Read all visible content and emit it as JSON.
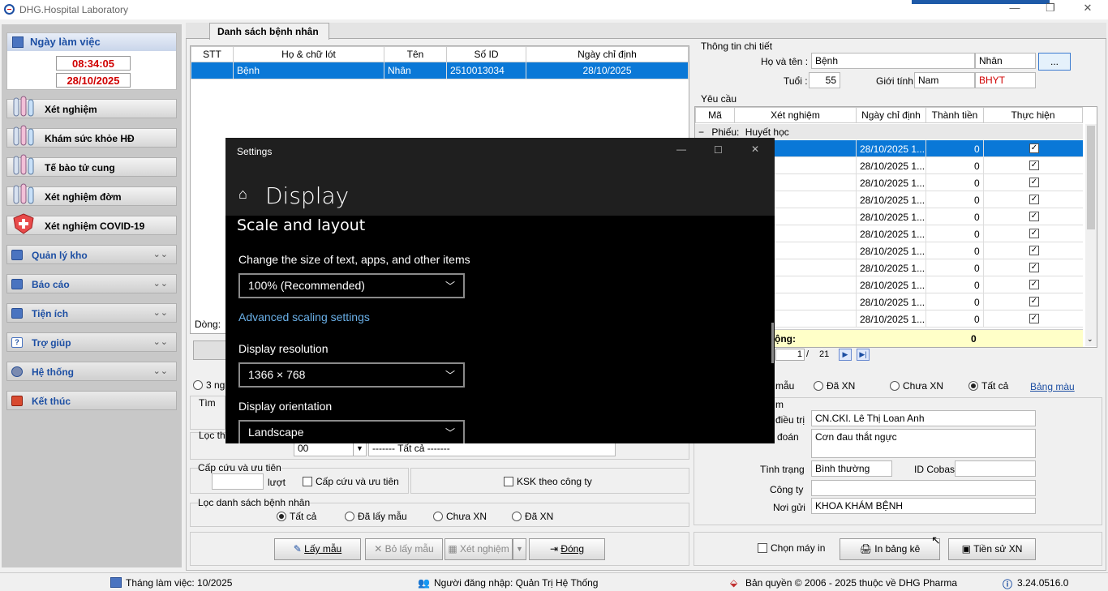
{
  "app": {
    "title": "DHG.Hospital Laboratory"
  },
  "left": {
    "working_day_label": "Ngày làm việc",
    "time": "08:34:05",
    "date": "28/10/2025",
    "nav": [
      "Xét nghiệm",
      "Khám sức khỏe HĐ",
      "Tế bào tử cung",
      "Xét nghiệm đờm",
      "Xét nghiệm COVID-19"
    ],
    "groups": [
      "Quản lý kho",
      "Báo cáo",
      "Tiện ích",
      "Trợ giúp",
      "Hệ thống",
      "Kết thúc"
    ]
  },
  "tab": {
    "label": "Danh sách bệnh nhân"
  },
  "patients": {
    "headers": [
      "STT",
      "Họ & chữ lót",
      "Tên",
      "Số ID",
      "Ngày chỉ định"
    ],
    "rows": [
      [
        "",
        "Bệnh",
        "Nhân",
        "2510013034",
        "28/10/2025"
      ]
    ],
    "row_count_label": "Dòng:"
  },
  "detail": {
    "title": "Thông tin chi tiết",
    "name_label": "Họ và tên :",
    "last": "Bệnh",
    "first": "Nhân",
    "more": "...",
    "age_label": "Tuổi :",
    "age": "55",
    "gender_label": "Giới tính :",
    "gender": "Nam",
    "insurance": "BHYT"
  },
  "request": {
    "title": "Yêu cầu",
    "headers": [
      "Mã",
      "Xét nghiệm",
      "Ngày chỉ định",
      "Thành tiền",
      "Thực hiện"
    ],
    "group_label": "Phiếu:",
    "group_name": "Huyết học",
    "row_date": "28/10/2025 1...",
    "row_amount": "0",
    "total_label": "ộng:",
    "total": "0",
    "page": "1",
    "page_total": "21"
  },
  "filters_right": {
    "sample_suffix": "mẫu",
    "done": "Đã XN",
    "notdone": "Chưa XN",
    "all": "Tất cả",
    "color_table": "Bảng màu"
  },
  "info": {
    "doctor_label": "điều trị",
    "doctor": "CN.CKI. Lê Thị Loan Anh",
    "diag_label": "đoán",
    "diag": "Cơn đau thắt ngực",
    "state_label": "Tình trạng",
    "state": "Bình thường",
    "cobas_label": "ID Cobas:",
    "cobas": "",
    "company_label": "Công ty",
    "company": "",
    "sender_label": "Nơi gửi",
    "sender": "KHOA KHÁM BỆNH",
    "partial_m": "m"
  },
  "bottom_right": {
    "choose_printer": "Chọn máy in",
    "print": "In bảng kê",
    "history": "Tiền sử XN"
  },
  "filters_left": {
    "days_partial": "3 ng",
    "find": "Tìm",
    "filter_partial": "Lọc the",
    "combo_value": "00",
    "combo_all": "------- Tất cả -------",
    "emergency_title": "Cấp cứu và ưu tiên",
    "turns": "lượt",
    "emergency_check": "Cấp cứu và ưu tiên",
    "ksk_check": "KSK theo công ty",
    "list_filter_title": "Lọc danh sách bệnh nhân",
    "opt_all": "Tất cả",
    "opt_sampled": "Đã lấy mẫu",
    "opt_notdone": "Chưa XN",
    "opt_done": "Đã XN"
  },
  "actions": {
    "take": "Lấy mẫu",
    "untake": "Bỏ lấy mẫu",
    "test": "Xét nghiệm",
    "close": "Đóng"
  },
  "status": {
    "month": "Tháng làm việc: 10/2025",
    "user": "Người đăng nhập: Quản Trị Hệ Thống",
    "copyright": "Bản quyền © 2006 - 2025 thuộc về DHG Pharma",
    "version": "3.24.0516.0"
  },
  "settings": {
    "window_title": "Settings",
    "page_title": "Display",
    "section": "Scale and layout",
    "scale_label": "Change the size of text, apps, and other items",
    "scale_value": "100% (Recommended)",
    "advanced": "Advanced scaling settings",
    "res_label": "Display resolution",
    "res_value": "1366 × 768",
    "orient_label": "Display orientation",
    "orient_value": "Landscape"
  }
}
